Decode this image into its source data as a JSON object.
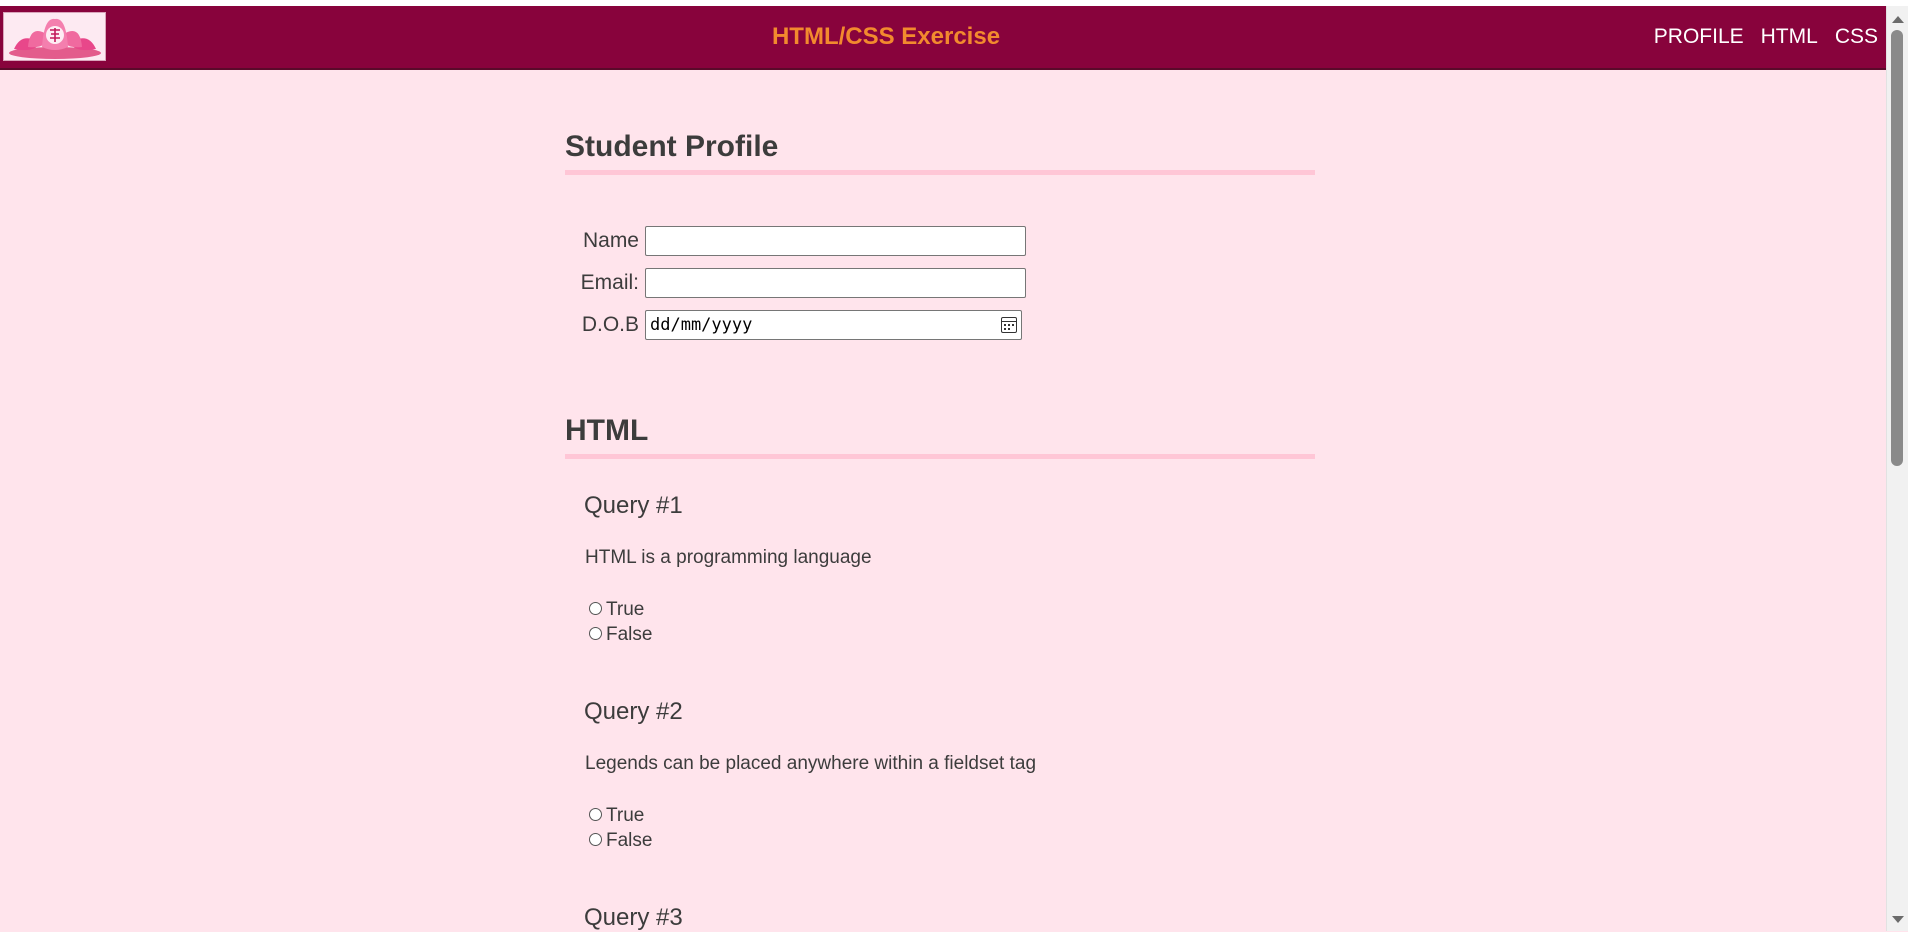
{
  "header": {
    "title": "HTML/CSS Exercise",
    "nav": [
      "PROFILE",
      "HTML",
      "CSS"
    ],
    "colors": {
      "bar": "#88033c",
      "title": "#f28a2e",
      "background": "#ffe4ec"
    }
  },
  "logo": {
    "icon": "lotus-logo-icon"
  },
  "profile": {
    "heading": "Student Profile",
    "name_label": "Name",
    "email_label": "Email:",
    "dob_label": "D.O.B",
    "dob_value": "dd/mm/yyyy",
    "name_value": "",
    "email_value": ""
  },
  "html_section": {
    "heading": "HTML",
    "queries": [
      {
        "title": "Query #1",
        "text": "HTML is a programming language",
        "options": [
          "True",
          "False"
        ]
      },
      {
        "title": "Query #2",
        "text": "Legends can be placed anywhere within a fieldset tag",
        "options": [
          "True",
          "False"
        ]
      },
      {
        "title": "Query #3"
      }
    ]
  }
}
